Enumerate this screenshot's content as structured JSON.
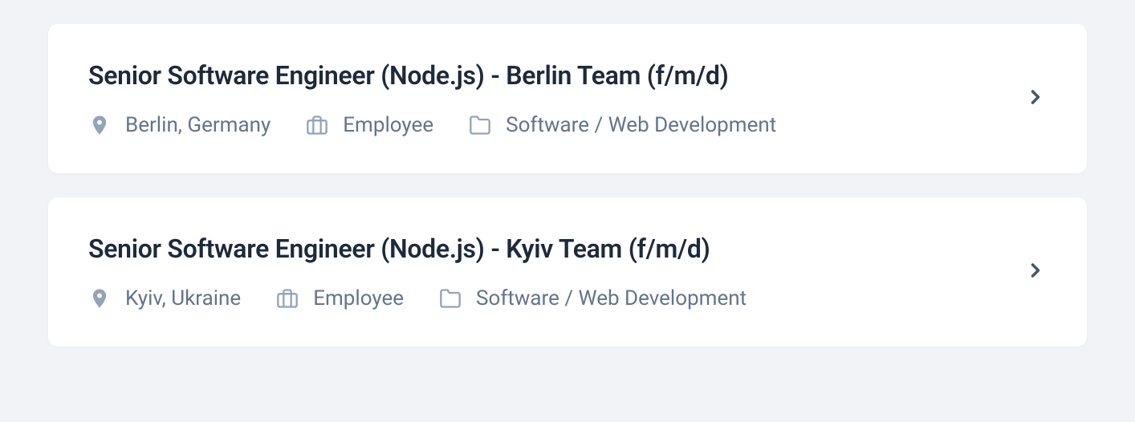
{
  "jobs": [
    {
      "title": "Senior Software Engineer (Node.js) - Berlin Team (f/m/d)",
      "location": "Berlin, Germany",
      "employment_type": "Employee",
      "category": "Software / Web Development"
    },
    {
      "title": "Senior Software Engineer (Node.js) - Kyiv Team (f/m/d)",
      "location": "Kyiv, Ukraine",
      "employment_type": "Employee",
      "category": "Software / Web Development"
    }
  ]
}
